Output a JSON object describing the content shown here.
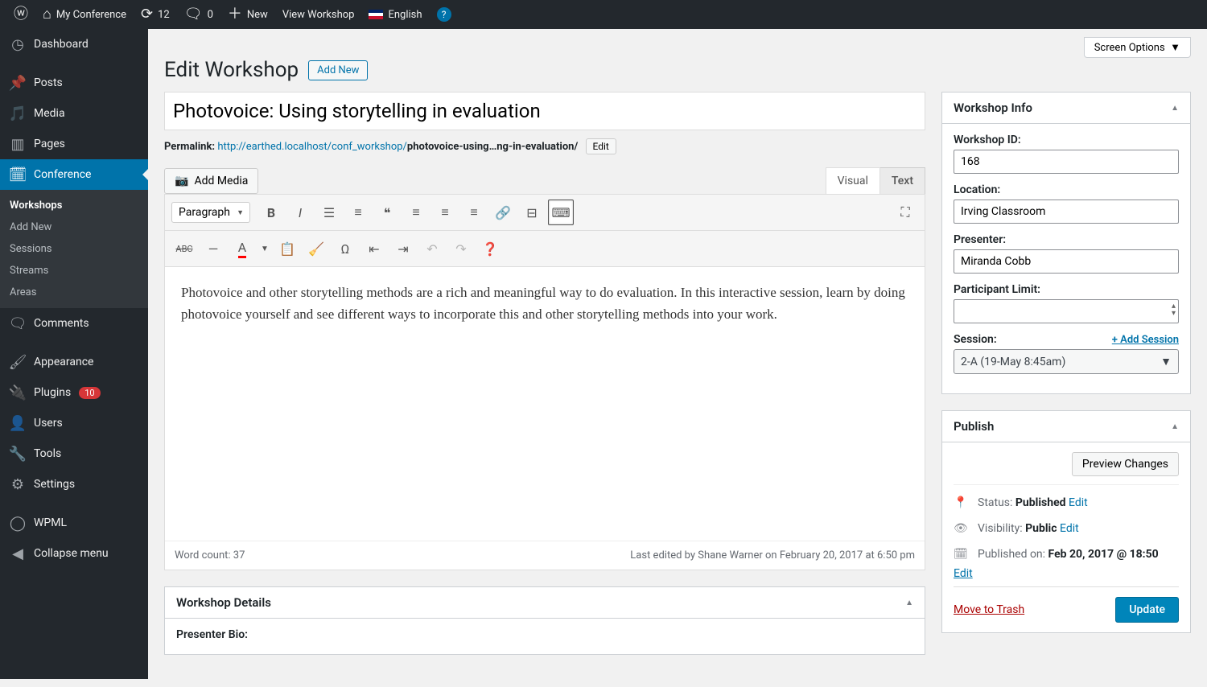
{
  "adminbar": {
    "site": "My Conference",
    "updates": "12",
    "comments": "0",
    "new": "New",
    "view": "View Workshop",
    "lang": "English"
  },
  "sidebar": {
    "items": [
      {
        "icon": "dashboard",
        "label": "Dashboard"
      },
      {
        "icon": "pin",
        "label": "Posts"
      },
      {
        "icon": "media",
        "label": "Media"
      },
      {
        "icon": "page",
        "label": "Pages"
      },
      {
        "icon": "calendar",
        "label": "Conference",
        "current": true
      },
      {
        "icon": "comment",
        "label": "Comments"
      },
      {
        "icon": "brush",
        "label": "Appearance"
      },
      {
        "icon": "plug",
        "label": "Plugins",
        "badge": "10"
      },
      {
        "icon": "user",
        "label": "Users"
      },
      {
        "icon": "wrench",
        "label": "Tools"
      },
      {
        "icon": "gear",
        "label": "Settings"
      },
      {
        "icon": "wpml",
        "label": "WPML"
      },
      {
        "icon": "collapse",
        "label": "Collapse menu"
      }
    ],
    "submenu": [
      "Workshops",
      "Add New",
      "Sessions",
      "Streams",
      "Areas"
    ]
  },
  "screen_options": "Screen Options",
  "page_heading": "Edit Workshop",
  "add_new": "Add New",
  "title": "Photovoice: Using storytelling in evaluation",
  "permalink_label": "Permalink:",
  "permalink_base": "http://earthed.localhost/conf_workshop/",
  "permalink_slug": "photovoice-using…ng-in-evaluation/",
  "edit_label": "Edit",
  "add_media": "Add Media",
  "tabs": {
    "visual": "Visual",
    "text": "Text"
  },
  "format_select": "Paragraph",
  "editor_content": "Photovoice and other storytelling methods are a rich and meaningful way to do evaluation. In this interactive session, learn by doing photovoice yourself and see different ways to incorporate this and other storytelling methods into your work.",
  "wordcount_label": "Word count: ",
  "wordcount": "37",
  "last_edited": "Last edited by Shane Warner on February 20, 2017 at 6:50 pm",
  "details_box": {
    "title": "Workshop Details",
    "presenter_bio_label": "Presenter Bio:"
  },
  "workshop_info": {
    "title": "Workshop Info",
    "id_label": "Workshop ID:",
    "id": "168",
    "location_label": "Location:",
    "location": "Irving Classroom",
    "presenter_label": "Presenter:",
    "presenter": "Miranda Cobb",
    "limit_label": "Participant Limit:",
    "limit": "",
    "session_label": "Session:",
    "add_session": "+ Add Session",
    "session_value": "2-A (19-May 8:45am)"
  },
  "publish": {
    "title": "Publish",
    "preview": "Preview Changes",
    "status_label": "Status: ",
    "status": "Published",
    "visibility_label": "Visibility: ",
    "visibility": "Public",
    "published_label": "Published on: ",
    "published": "Feb 20, 2017 @ 18:50",
    "edit": "Edit",
    "trash": "Move to Trash",
    "update": "Update"
  }
}
